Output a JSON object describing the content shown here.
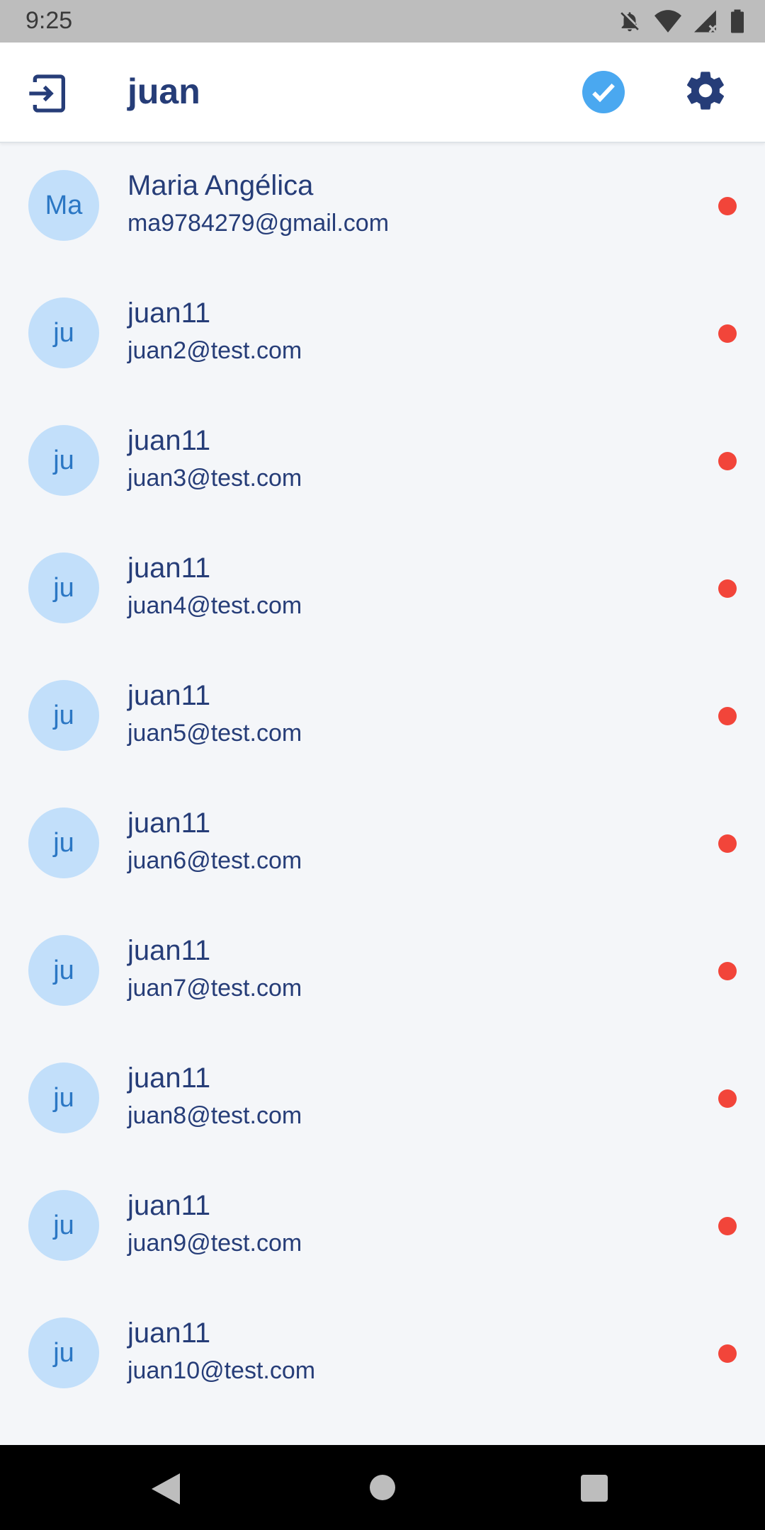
{
  "status_bar": {
    "time": "9:25",
    "icons": [
      "notifications-off-icon",
      "wifi-icon",
      "cell-signal-icon",
      "battery-icon"
    ]
  },
  "header": {
    "title": "juan",
    "left_icon": "logout-icon",
    "right_icons": [
      "verified-check-icon",
      "settings-gear-icon"
    ]
  },
  "contacts": [
    {
      "initials": "Ma",
      "name": "Maria Angélica",
      "email": "ma9784279@gmail.com",
      "status": "offline"
    },
    {
      "initials": "ju",
      "name": "juan11",
      "email": "juan2@test.com",
      "status": "offline"
    },
    {
      "initials": "ju",
      "name": "juan11",
      "email": "juan3@test.com",
      "status": "offline"
    },
    {
      "initials": "ju",
      "name": "juan11",
      "email": "juan4@test.com",
      "status": "offline"
    },
    {
      "initials": "ju",
      "name": "juan11",
      "email": "juan5@test.com",
      "status": "offline"
    },
    {
      "initials": "ju",
      "name": "juan11",
      "email": "juan6@test.com",
      "status": "offline"
    },
    {
      "initials": "ju",
      "name": "juan11",
      "email": "juan7@test.com",
      "status": "offline"
    },
    {
      "initials": "ju",
      "name": "juan11",
      "email": "juan8@test.com",
      "status": "offline"
    },
    {
      "initials": "ju",
      "name": "juan11",
      "email": "juan9@test.com",
      "status": "offline"
    },
    {
      "initials": "ju",
      "name": "juan11",
      "email": "juan10@test.com",
      "status": "offline"
    }
  ],
  "colors": {
    "primary_text": "#263d78",
    "avatar_bg": "#c2dffa",
    "avatar_text": "#2b77c4",
    "status_offline": "#f2453a",
    "verified": "#4aa8f0",
    "background": "#f4f6f9"
  },
  "nav_bar": {
    "icons": [
      "back-icon",
      "home-icon",
      "recents-icon"
    ]
  }
}
